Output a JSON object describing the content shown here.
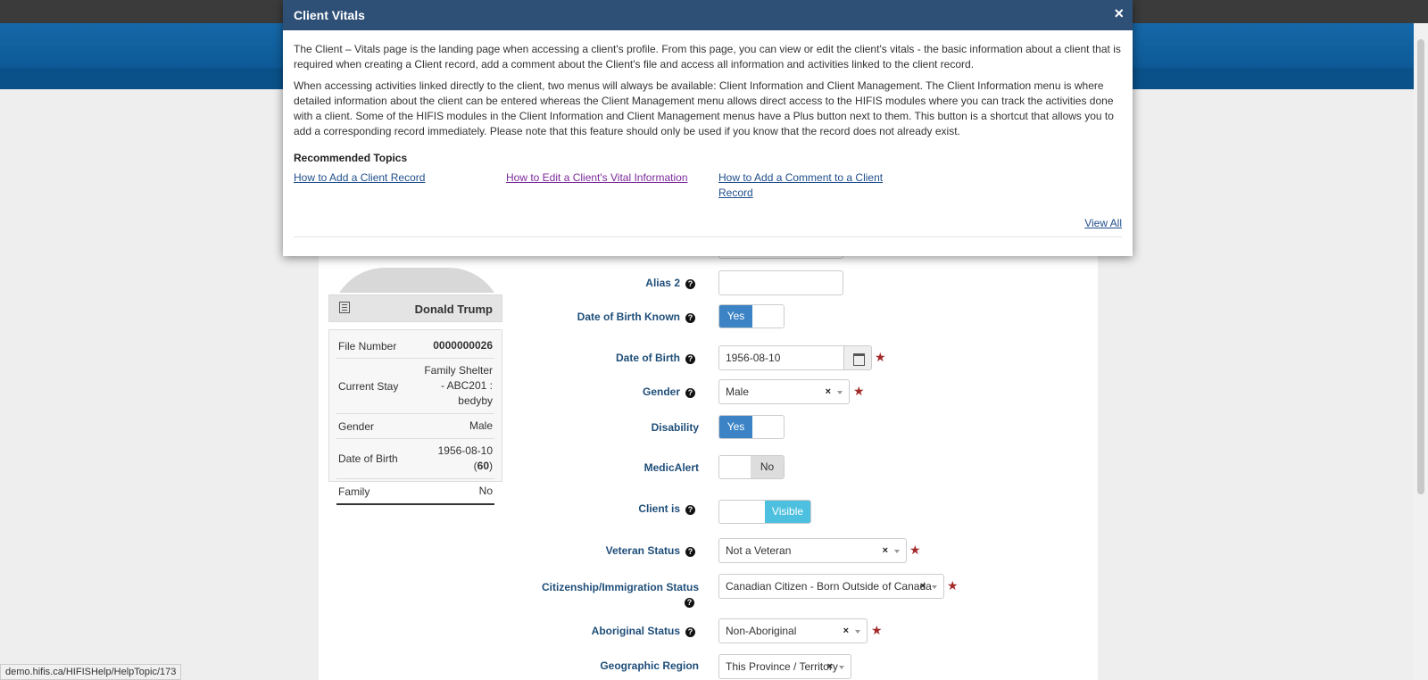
{
  "modal": {
    "title": "Client Vitals",
    "close_symbol": "×",
    "paragraph_1": "The Client – Vitals page is the landing page when accessing a client's profile. From this page, you can view or edit the client's vitals - the basic information about a client that is required when creating a Client record, add a comment about the Client's file and access all information and activities linked to the client record.",
    "paragraph_2": "When accessing activities linked directly to the client, two menus will always be available: Client Information and Client Management. The Client Information menu is where detailed information about the client can be entered whereas the Client Management menu allows direct access to the HIFIS modules where you can track the activities done with a client. Some of the HIFIS modules in the Client Information and Client Management menus have a Plus button next to them. This button is a shortcut that allows you to add a corresponding record immediately. Please note that this feature should only be used if you know that the record does not already exist.",
    "recommended_title": "Recommended Topics",
    "topics": [
      "How to Add a Client Record",
      "How to Edit a Client's Vital Information",
      "How to Add a Comment to a Client Record"
    ],
    "view_all": "View All"
  },
  "client": {
    "name": "Donald Trump",
    "info": [
      {
        "label": "File Number",
        "value": "0000000026"
      },
      {
        "label": "Current Stay",
        "value": "Family Shelter - ABC201 : bedyby"
      },
      {
        "label": "Gender",
        "value": "Male"
      },
      {
        "label": "Date of Birth",
        "value": "1956-08-10",
        "age": "60"
      },
      {
        "label": "Family",
        "value": "No"
      }
    ]
  },
  "form": {
    "alias2_label": "Alias 2",
    "alias2_value": "",
    "dob_known_label": "Date of Birth Known",
    "dob_known_value": "Yes",
    "dob_label": "Date of Birth",
    "dob_value": "1956-08-10",
    "gender_label": "Gender",
    "gender_value": "Male",
    "disability_label": "Disability",
    "disability_value": "Yes",
    "medicalert_label": "MedicAlert",
    "medicalert_value": "No",
    "client_is_label": "Client is",
    "client_is_value": "Visible",
    "veteran_label": "Veteran Status",
    "veteran_value": "Not a Veteran",
    "citizenship_label": "Citizenship/Immigration Status",
    "citizenship_value": "Canadian Citizen - Born Outside of Canada",
    "aboriginal_label": "Aboriginal Status",
    "aboriginal_value": "Non-Aboriginal",
    "region_label": "Geographic Region",
    "region_value": "This Province / Territory"
  },
  "statusbar": {
    "url": "demo.hifis.ca/HIFISHelp/HelpTopic/173"
  },
  "colors": {
    "modal_header": "#2e5077",
    "banner": "#0d5a97",
    "label": "#1f4e79",
    "toggle_on": "#3c83c5",
    "visible_toggle": "#4cc0de",
    "required_star": "#a52a2a"
  }
}
